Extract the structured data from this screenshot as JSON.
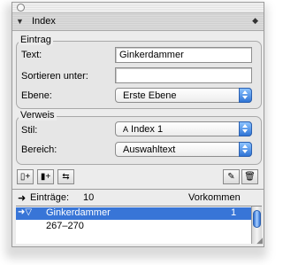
{
  "panel": {
    "title": "Index",
    "collapse_glyph": "▼",
    "menu_glyph": "◆"
  },
  "entry_group": {
    "label": "Eintrag",
    "text_label": "Text:",
    "text_value": "Ginkerdammer",
    "sort_label": "Sortieren unter:",
    "sort_value": "",
    "level_label": "Ebene:",
    "level_value": "Erste Ebene"
  },
  "reference_group": {
    "label": "Verweis",
    "style_label": "Stil:",
    "style_glyph": "A",
    "style_value": "Index 1",
    "scope_label": "Bereich:",
    "scope_value": "Auswahltext"
  },
  "toolbar": {
    "add_entry_glyph": "▯+",
    "add_all_glyph": "▮+",
    "move_glyph": "⇆",
    "edit_glyph": "✎",
    "delete_glyph": "🗑"
  },
  "list": {
    "entries_label": "Einträge:",
    "entries_count": "10",
    "occurrences_label": "Vorkommen",
    "rows": [
      {
        "text": "Ginkerdammer",
        "count": "1",
        "selected": true
      },
      {
        "text": "267–270",
        "count": "",
        "selected": false
      }
    ]
  }
}
